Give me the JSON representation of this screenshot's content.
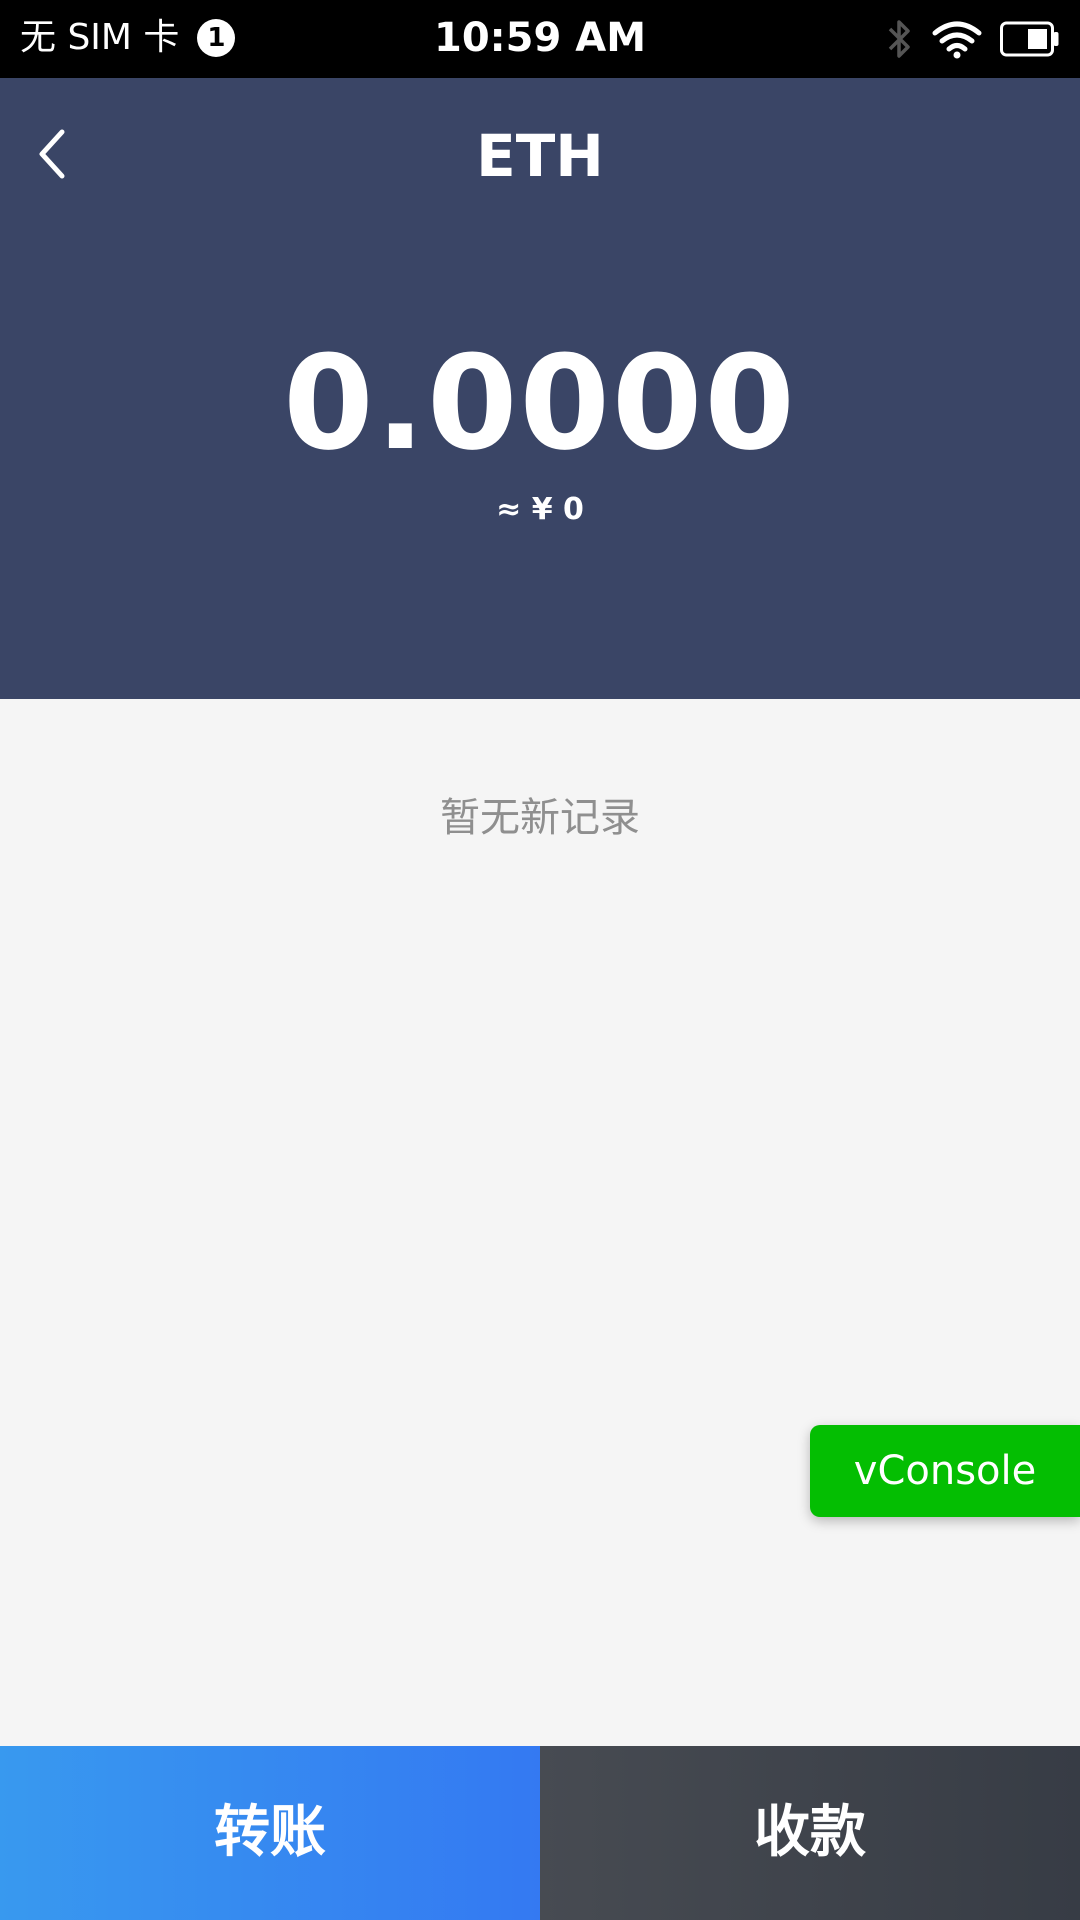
{
  "status_bar": {
    "carrier": "无 SIM 卡",
    "sim_slot": "1",
    "time": "10:59 AM",
    "icons": [
      "bluetooth-icon",
      "wifi-icon",
      "battery-icon"
    ]
  },
  "header": {
    "title": "ETH",
    "balance": "0.0000",
    "fiat_value": "≈ ¥ 0",
    "background_color": "#3a4566"
  },
  "records": {
    "empty_text": "暂无新记录"
  },
  "debug": {
    "vconsole_label": "vConsole",
    "color": "#04be02"
  },
  "actions": {
    "transfer_label": "转账",
    "receive_label": "收款",
    "transfer_color": "#3479f2",
    "receive_color": "#3f444c"
  }
}
